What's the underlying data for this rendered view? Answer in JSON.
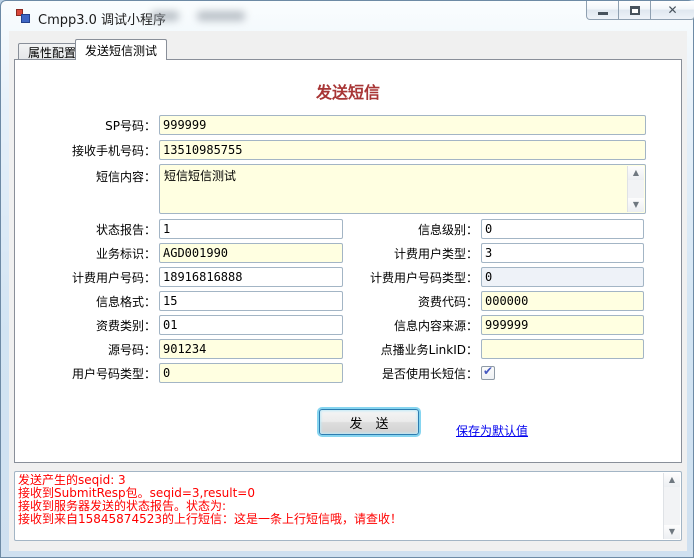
{
  "window": {
    "title": "Cmpp3.0 调试小程序"
  },
  "icons": {
    "close": "✕",
    "check": "✔",
    "scroll_up": "▲",
    "scroll_down": "▼"
  },
  "tabs": {
    "config": "属性配置",
    "send_test": "发送短信测试"
  },
  "form": {
    "heading": "发送短信",
    "top_rows": [
      {
        "label": "SP号码：",
        "value": "999999"
      },
      {
        "label": "接收手机号码：",
        "value": "13510985755"
      }
    ],
    "message": {
      "label": "短信内容：",
      "value": "短信短信测试"
    },
    "left_rows": [
      {
        "label": "状态报告：",
        "value": "1"
      },
      {
        "label": "业务标识：",
        "value": "AGD001990"
      },
      {
        "label": "计费用户号码：",
        "value": "18916816888"
      },
      {
        "label": "信息格式：",
        "value": "15"
      },
      {
        "label": "资费类别：",
        "value": "01"
      },
      {
        "label": "源号码：",
        "value": "901234"
      },
      {
        "label": "用户号码类型：",
        "value": "0"
      }
    ],
    "right_rows": [
      {
        "label": "信息级别：",
        "value": "0"
      },
      {
        "label": "计费用户类型：",
        "value": "3"
      },
      {
        "label": "计费用户号码类型：",
        "value": "0"
      },
      {
        "label": "资费代码：",
        "value": "000000"
      },
      {
        "label": "信息内容来源：",
        "value": "999999"
      },
      {
        "label": "点播业务LinkID：",
        "value": ""
      }
    ],
    "long_sms": {
      "label": "是否使用长短信：",
      "checked": "checked"
    }
  },
  "actions": {
    "send": "发　送",
    "save_default": "保存为默认值"
  },
  "log": {
    "lines": [
      "发送产生的seqid: 3",
      "接收到SubmitResp包。seqid=3,result=0",
      "接收到服务器发送的状态报告。状态为:",
      "接收到来自15845874523的上行短信：这是一条上行短信哦，请查收！"
    ]
  },
  "colors": {
    "heading_red": "#a83535",
    "log_red": "#ff0000",
    "link_blue": "#0000ee",
    "input_yellow": "#ffffe1",
    "readonly_gray": "#eef2f8",
    "focus_glow_cyan": "#86d5f0",
    "frame_blue": "#d2e4f3"
  }
}
